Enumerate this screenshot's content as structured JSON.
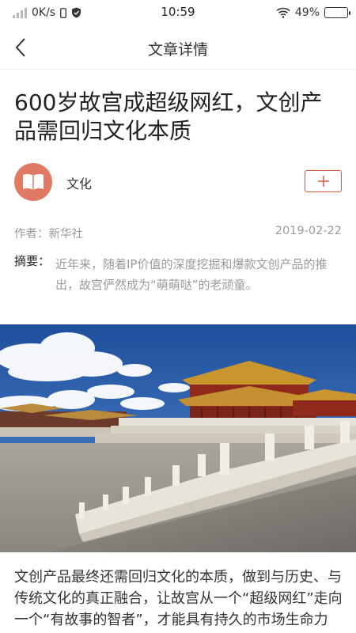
{
  "status": {
    "speed": "0K/s",
    "time": "10:59",
    "battery": "49%",
    "battery_level": 0.49
  },
  "nav": {
    "title": "文章详情"
  },
  "article": {
    "title": "600岁故宫成超级网红，文创产品需回归文化本质",
    "channel": "文化",
    "author_label": "作者：",
    "author": "新华社",
    "date": "2019-02-22",
    "summary_label": "摘要：",
    "summary": "近年来，随着IP价值的深度挖掘和爆款文创产品的推出，故宫俨然成为“萌萌哒”的老顽童。",
    "body": "文创产品最终还需回归文化的本质，做到与历史、与传统文化的真正融合，让故宫从一个“超级网红”走向一个“有故事的智者”，才能具有持久的市场生命力"
  },
  "colors": {
    "accent": "#d45a48",
    "channel_avatar": "#e07a64"
  },
  "icons": {
    "back": "chevron-left-icon",
    "follow": "plus-icon",
    "channel": "book-icon"
  }
}
